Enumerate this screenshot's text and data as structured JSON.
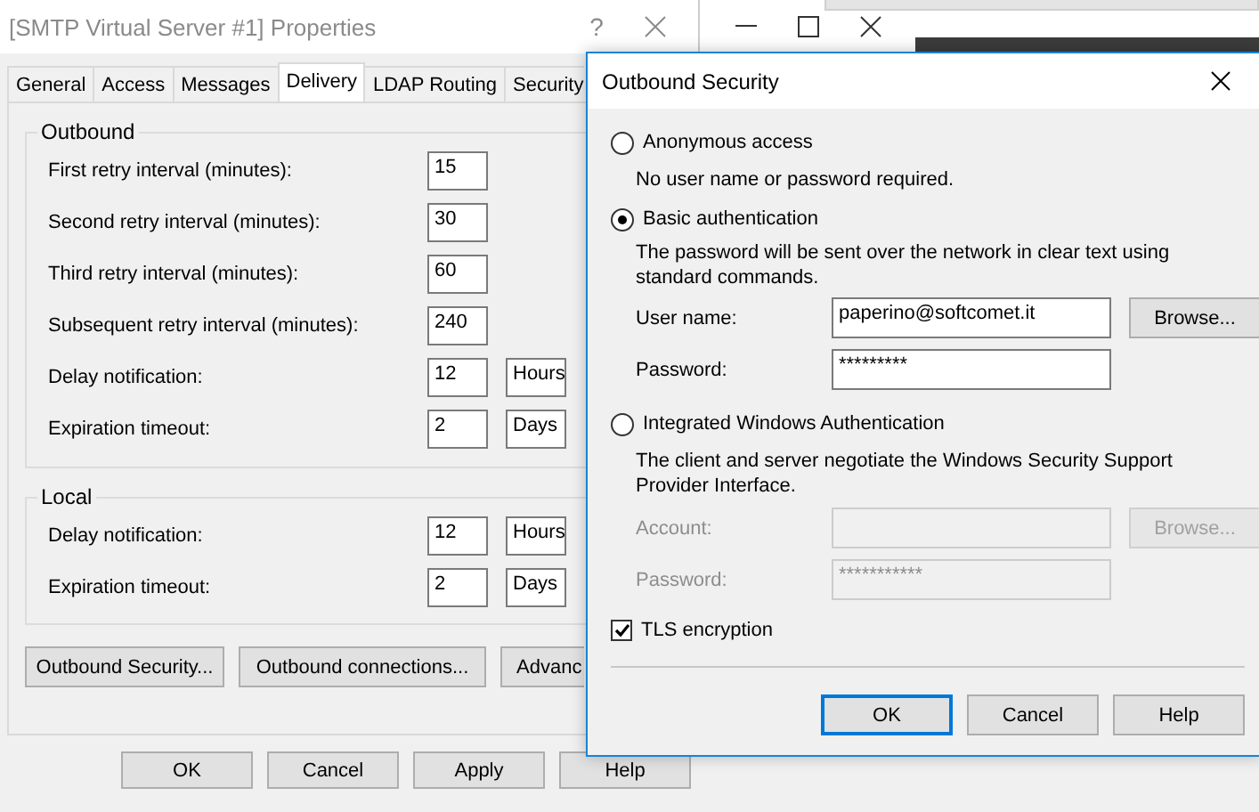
{
  "properties_dialog": {
    "title": "[SMTP Virtual Server #1] Properties",
    "help_glyph": "?",
    "tabs": [
      {
        "label": "General",
        "selected": false
      },
      {
        "label": "Access",
        "selected": false
      },
      {
        "label": "Messages",
        "selected": false
      },
      {
        "label": "Delivery",
        "selected": true
      },
      {
        "label": "LDAP Routing",
        "selected": false
      },
      {
        "label": "Security",
        "selected": false
      }
    ],
    "groups": [
      {
        "title": "Outbound",
        "rows": [
          {
            "label": "First retry interval (minutes):",
            "value": "15"
          },
          {
            "label": "Second retry interval (minutes):",
            "value": "30"
          },
          {
            "label": "Third retry interval (minutes):",
            "value": "60"
          },
          {
            "label": "Subsequent retry interval (minutes):",
            "value": "240"
          },
          {
            "label": "Delay notification:",
            "value": "12",
            "unit": "Hours"
          },
          {
            "label": "Expiration timeout:",
            "value": "2",
            "unit": "Days"
          }
        ]
      },
      {
        "title": "Local",
        "rows": [
          {
            "label": "Delay notification:",
            "value": "12",
            "unit": "Hours"
          },
          {
            "label": "Expiration timeout:",
            "value": "2",
            "unit": "Days"
          }
        ]
      }
    ],
    "buttons": [
      "Outbound Security...",
      "Outbound connections...",
      "Advanc"
    ],
    "footer_buttons": [
      "OK",
      "Cancel",
      "Apply",
      "Help"
    ]
  },
  "outbound_security_dialog": {
    "title": "Outbound Security",
    "options": [
      {
        "label": "Anonymous access",
        "selected": false,
        "description": "No user name or password required."
      },
      {
        "label": "Basic authentication",
        "selected": true,
        "description": "The password will be sent over the network in clear text using standard commands.",
        "fields": [
          {
            "label": "User name:",
            "value": "paperino@softcomet.it",
            "disabled": false,
            "browse": "Browse..."
          },
          {
            "label": "Password:",
            "value": "*********",
            "disabled": false
          }
        ]
      },
      {
        "label": "Integrated Windows Authentication",
        "selected": false,
        "description": "The client and server negotiate the Windows Security Support Provider Interface.",
        "fields": [
          {
            "label": "Account:",
            "disabled": true,
            "browse": "Browse..."
          },
          {
            "label": "Password:",
            "value": "***********",
            "disabled": true
          }
        ]
      }
    ],
    "tls": {
      "label": "TLS encryption",
      "checked": true
    },
    "buttons": [
      "OK",
      "Cancel",
      "Help"
    ]
  }
}
